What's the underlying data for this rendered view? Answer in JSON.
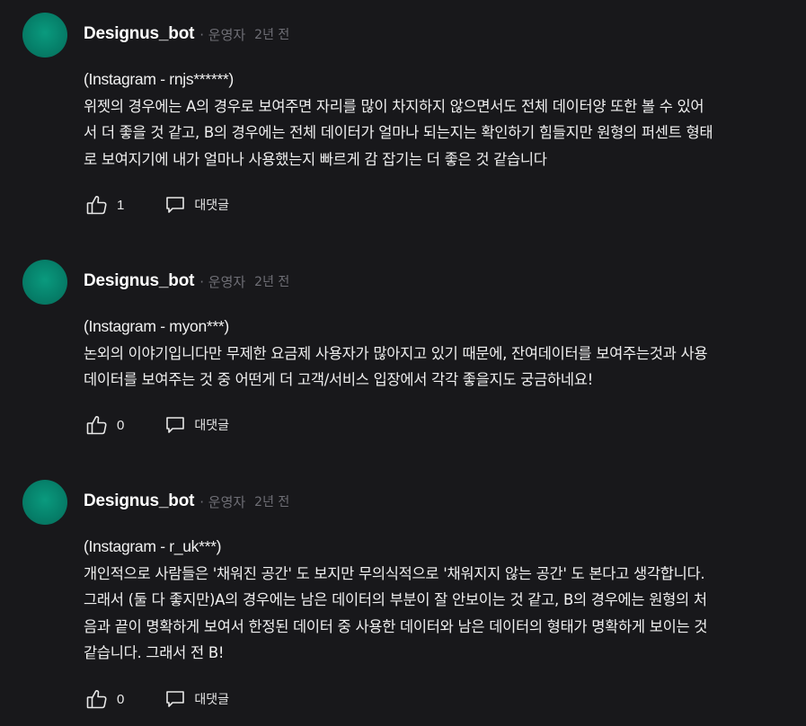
{
  "comments": [
    {
      "author": "Designus_bot",
      "role": "· 운영자",
      "time": "2년 전",
      "source": "(Instagram - rnjs******)",
      "text": "위젯의 경우에는 A의 경우로 보여주면 자리를 많이 차지하지 않으면서도 전체 데이터양 또한 볼 수 있어\n서 더 좋을 것 같고, B의 경우에는 전체 데이터가 얼마나 되는지는 확인하기 힘들지만 원형의 퍼센트 형태\n로 보여지기에 내가 얼마나 사용했는지 빠르게 감 잡기는 더 좋은 것 같습니다",
      "likes": "1",
      "reply_label": "대댓글"
    },
    {
      "author": "Designus_bot",
      "role": "· 운영자",
      "time": "2년 전",
      "source": "(Instagram - myon***)",
      "text": "논외의 이야기입니다만 무제한 요금제 사용자가 많아지고 있기 때문에, 잔여데이터를 보여주는것과 사용\n데이터를 보여주는 것 중 어떤게 더 고객/서비스 입장에서 각각 좋을지도 궁금하네요!",
      "likes": "0",
      "reply_label": "대댓글"
    },
    {
      "author": "Designus_bot",
      "role": "· 운영자",
      "time": "2년 전",
      "source": "(Instagram - r_uk***)",
      "text": "개인적으로 사람들은 '채워진 공간' 도 보지만 무의식적으로 '채워지지 않는 공간' 도 본다고 생각합니다.\n그래서 (둘 다 좋지만)A의 경우에는 남은 데이터의 부분이 잘 안보이는 것 같고, B의 경우에는 원형의 처\n음과 끝이 명확하게 보여서 한정된 데이터 중 사용한 데이터와 남은 데이터의 형태가 명확하게 보이는 것\n같습니다. 그래서 전 B!",
      "likes": "0",
      "reply_label": "대댓글"
    }
  ]
}
